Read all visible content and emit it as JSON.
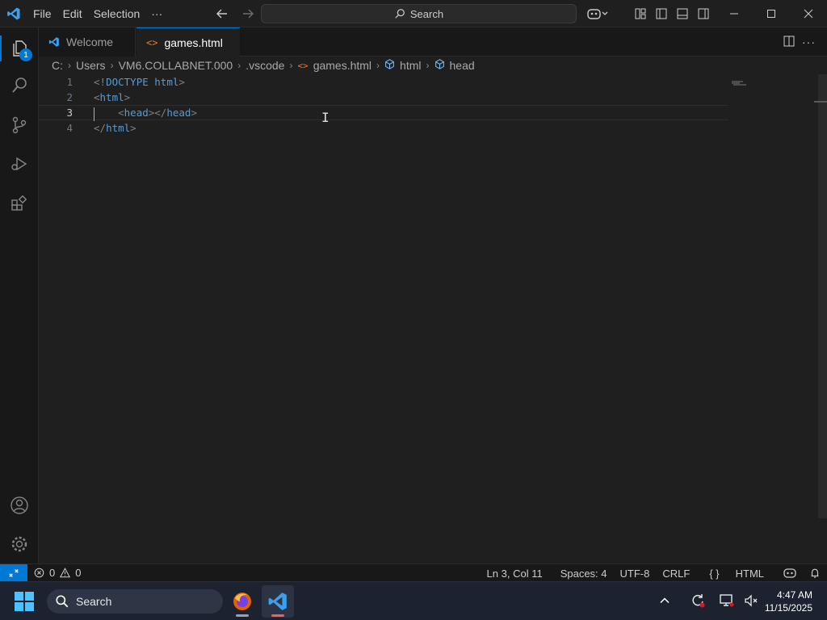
{
  "titlebar": {
    "menu": [
      "File",
      "Edit",
      "Selection",
      "···"
    ],
    "search_placeholder": "Search"
  },
  "activity": {
    "explorer_badge": "1"
  },
  "tabs": [
    {
      "label": "Welcome",
      "active": false
    },
    {
      "label": "games.html",
      "active": true,
      "modified": true
    }
  ],
  "breadcrumb": [
    "C:",
    "Users",
    "VM6.COLLABNET.000",
    ".vscode",
    "games.html",
    "html",
    "head"
  ],
  "editor": {
    "line_numbers": [
      "1",
      "2",
      "3",
      "4"
    ],
    "lines": [
      {
        "p1": "<!",
        "t1": "DOCTYPE",
        "w1": " ",
        "t2": "html",
        "p2": ">"
      },
      {
        "p1": "<",
        "t1": "html",
        "p2": ">"
      },
      {
        "indent": "    ",
        "p1": "<",
        "t1": "head",
        "p2": "></",
        "t2": "head",
        "p3": ">"
      },
      {
        "p1": "</",
        "t1": "html",
        "p2": ">"
      }
    ],
    "current_line": 3
  },
  "statusbar": {
    "errors": "0",
    "warnings": "0",
    "position": "Ln 3, Col 11",
    "spaces": "Spaces: 4",
    "encoding": "UTF-8",
    "eol": "CRLF",
    "language": "HTML"
  },
  "taskbar": {
    "search_label": "Search",
    "time": "4:47 AM",
    "date": "11/15/2025"
  },
  "colors": {
    "accent": "#0078d4",
    "tag": "#569cd6",
    "punct": "#808080"
  }
}
